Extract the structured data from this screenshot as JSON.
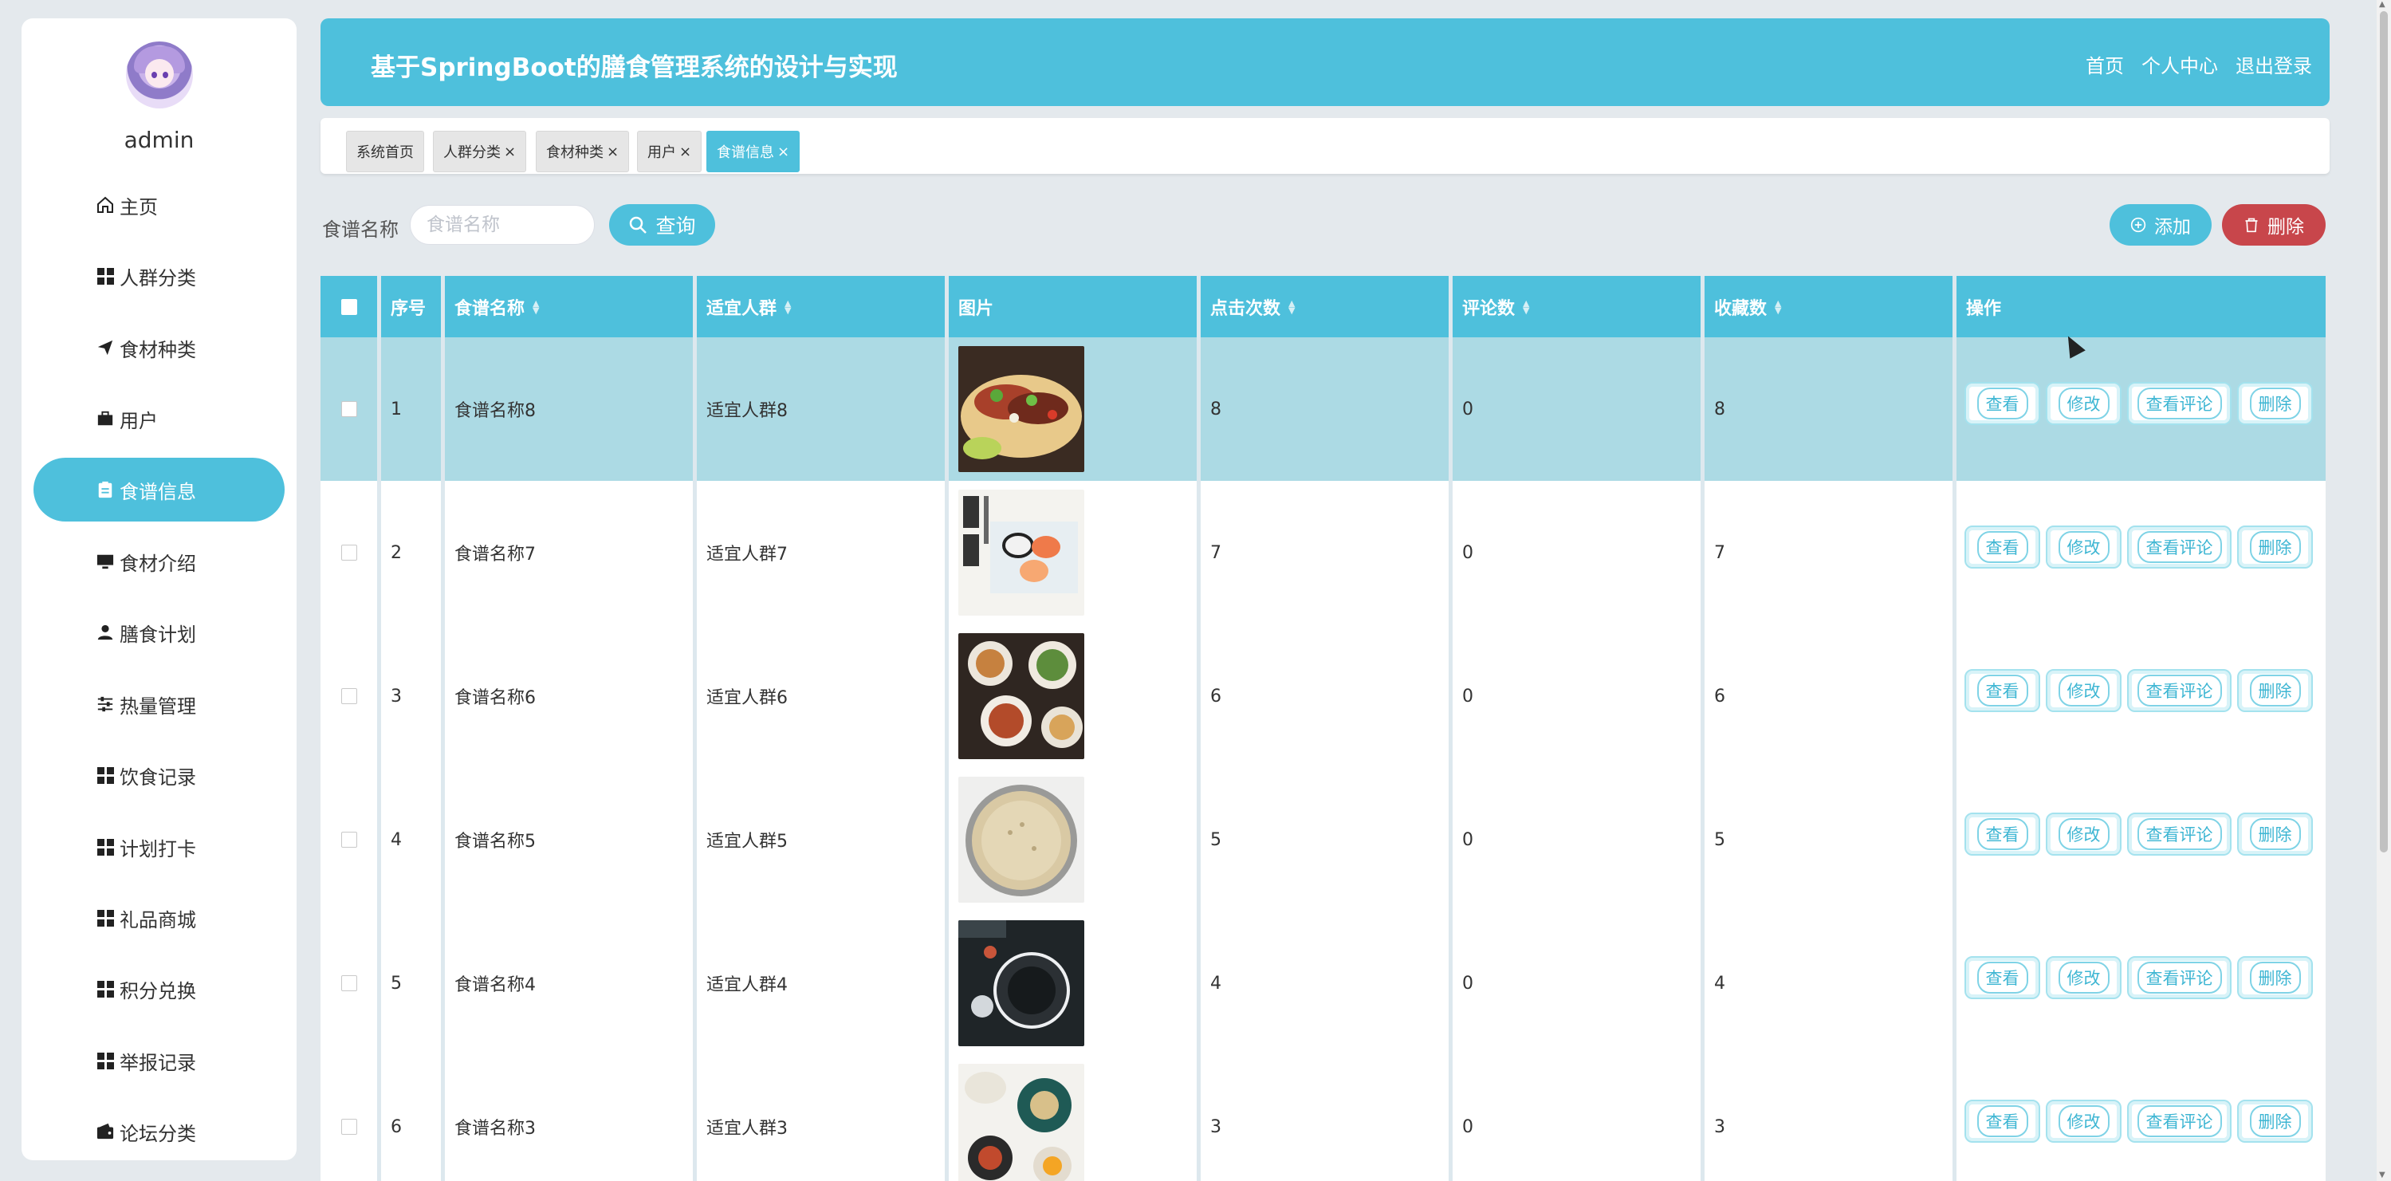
{
  "app": {
    "title": "基于SpringBoot的膳食管理系统的设计与实现",
    "header_links": [
      "首页",
      "个人中心",
      "退出登录"
    ]
  },
  "user": {
    "name": "admin"
  },
  "sidebar": {
    "items": [
      {
        "label": "主页",
        "icon": "home-icon"
      },
      {
        "label": "人群分类",
        "icon": "grid-icon"
      },
      {
        "label": "食材种类",
        "icon": "send-icon"
      },
      {
        "label": "用户",
        "icon": "briefcase-icon"
      },
      {
        "label": "食谱信息",
        "icon": "clipboard-icon",
        "active": true
      },
      {
        "label": "食材介绍",
        "icon": "monitor-icon"
      },
      {
        "label": "膳食计划",
        "icon": "person-icon"
      },
      {
        "label": "热量管理",
        "icon": "sliders-icon"
      },
      {
        "label": "饮食记录",
        "icon": "grid-icon"
      },
      {
        "label": "计划打卡",
        "icon": "grid-icon"
      },
      {
        "label": "礼品商城",
        "icon": "grid-icon"
      },
      {
        "label": "积分兑换",
        "icon": "grid-icon"
      },
      {
        "label": "举报记录",
        "icon": "grid-icon"
      },
      {
        "label": "论坛分类",
        "icon": "wallet-icon"
      }
    ]
  },
  "tabs": [
    {
      "label": "系统首页",
      "closable": false
    },
    {
      "label": "人群分类",
      "closable": true
    },
    {
      "label": "食材种类",
      "closable": true
    },
    {
      "label": "用户",
      "closable": true
    },
    {
      "label": "食谱信息",
      "closable": true,
      "active": true
    }
  ],
  "search": {
    "label": "食谱名称",
    "placeholder": "食谱名称",
    "query_label": "查询",
    "add_label": "添加",
    "delete_label": "删除"
  },
  "table": {
    "columns": [
      "序号",
      "食谱名称",
      "适宜人群",
      "图片",
      "点击次数",
      "评论数",
      "收藏数",
      "操作"
    ],
    "sortable": [
      "食谱名称",
      "适宜人群",
      "点击次数",
      "评论数",
      "收藏数"
    ],
    "actions": [
      "查看",
      "修改",
      "查看评论",
      "删除"
    ],
    "rows": [
      {
        "no": "1",
        "name": "食谱名称8",
        "crowd": "适宜人群8",
        "image": "tacos",
        "clicks": "8",
        "comments": "0",
        "favorites": "8"
      },
      {
        "no": "2",
        "name": "食谱名称7",
        "crowd": "适宜人群7",
        "image": "sushi-poster",
        "clicks": "7",
        "comments": "0",
        "favorites": "7"
      },
      {
        "no": "3",
        "name": "食谱名称6",
        "crowd": "适宜人群6",
        "image": "dishes-spread",
        "clicks": "6",
        "comments": "0",
        "favorites": "6"
      },
      {
        "no": "4",
        "name": "食谱名称5",
        "crowd": "适宜人群5",
        "image": "rice-pan",
        "clicks": "5",
        "comments": "0",
        "favorites": "5"
      },
      {
        "no": "5",
        "name": "食谱名称4",
        "crowd": "适宜人群4",
        "image": "dark-plate",
        "clicks": "4",
        "comments": "0",
        "favorites": "4"
      },
      {
        "no": "6",
        "name": "食谱名称3",
        "crowd": "适宜人群3",
        "image": "table-dishes",
        "clicks": "3",
        "comments": "0",
        "favorites": "3"
      }
    ]
  },
  "colors": {
    "accent": "#4ec0dc",
    "danger": "#c8464b",
    "highlight_row": "#acdae4",
    "background": "#e4e9ed"
  }
}
